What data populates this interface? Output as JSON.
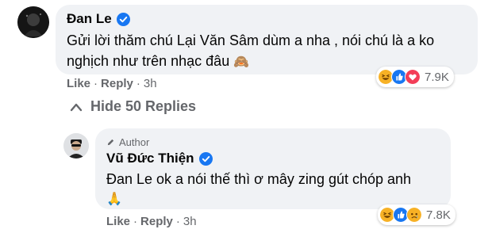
{
  "comment": {
    "author": "Đan Le",
    "text_line1": "Gửi lời thăm chú Lại Văn Sâm dùm a nha , nói chú là a ko",
    "text_line2": "nghịch như trên nhạc đâu",
    "emoji": "🙈",
    "like_label": "Like",
    "reply_label": "Reply",
    "time": "3h",
    "reaction_count": "7.9K",
    "reaction_icons": [
      "haha-icon",
      "like-icon",
      "love-icon"
    ]
  },
  "replies_toggle": {
    "label": "Hide 50 Replies",
    "icon": "chevron-up-icon"
  },
  "reply": {
    "badge": "Author",
    "badge_icon": "pencil-icon",
    "author": "Vũ Đức Thiện",
    "text": "Đan Le ok a nói thế thì ơ mây zing gút chóp anh",
    "emoji": "🙏",
    "like_label": "Like",
    "reply_label": "Reply",
    "time": "3h",
    "reaction_count": "7.8K",
    "reaction_icons": [
      "haha-icon",
      "like-icon",
      "sad-icon"
    ]
  },
  "colors": {
    "verified": "#1877f2",
    "bubble": "#f0f2f5",
    "meta": "#65676b",
    "haha": "#f7b125",
    "like": "#1877f2",
    "love": "#f33e58"
  }
}
